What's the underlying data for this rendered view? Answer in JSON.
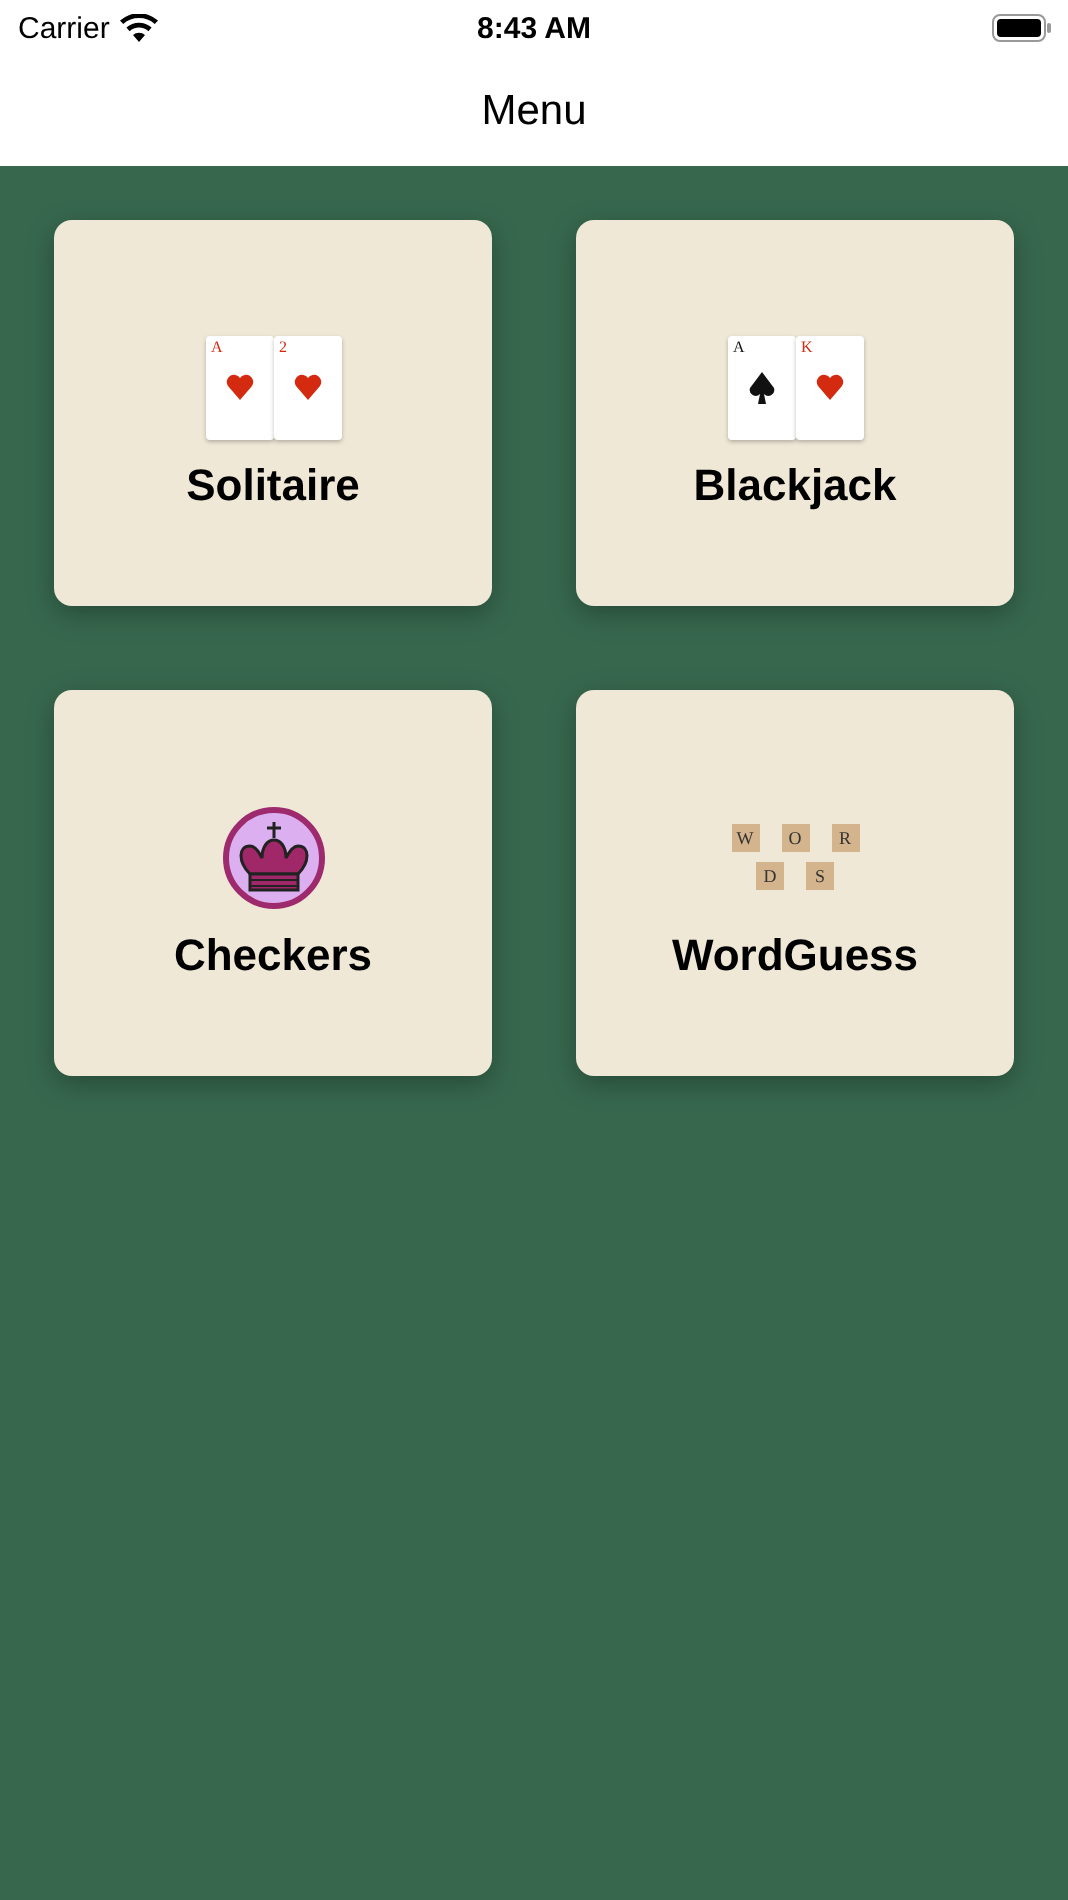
{
  "status_bar": {
    "carrier": "Carrier",
    "time": "8:43 AM"
  },
  "nav": {
    "title": "Menu"
  },
  "game_rows": [
    [
      {
        "title": "Solitaire",
        "kind": "cards",
        "cards": [
          {
            "rank": "A",
            "kind": "heart"
          },
          {
            "rank": "2",
            "kind": "heart"
          }
        ]
      },
      {
        "title": "Blackjack",
        "kind": "cards",
        "cards": [
          {
            "rank": "A",
            "kind": "spade"
          },
          {
            "rank": "K",
            "kind": "heart"
          }
        ]
      }
    ],
    [
      {
        "title": "Checkers",
        "kind": "crown"
      },
      {
        "title": "WordGuess",
        "kind": "tiles",
        "tiles": [
          [
            "W",
            "O",
            "R"
          ],
          [
            "D",
            "S"
          ]
        ]
      }
    ]
  ]
}
